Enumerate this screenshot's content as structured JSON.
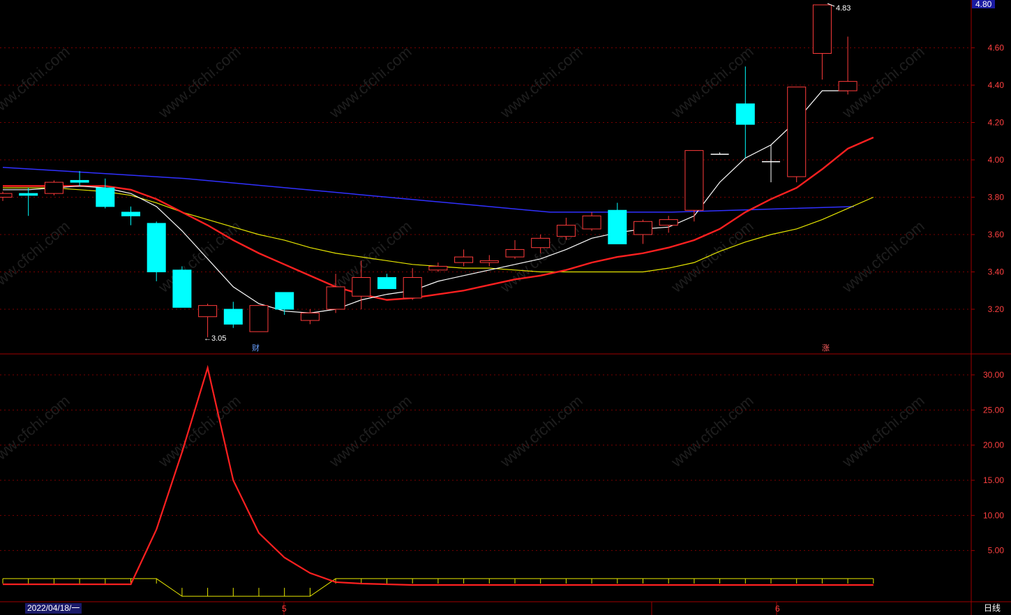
{
  "chart_data": {
    "type": "candlestick",
    "main_panel": {
      "y_ticks": [
        "3.20",
        "3.40",
        "3.60",
        "3.80",
        "4.00",
        "4.20",
        "4.40",
        "4.60"
      ],
      "ylim": [
        3.0,
        4.85
      ],
      "current_price_tag": "4.80",
      "candles": [
        {
          "o": 3.8,
          "h": 3.83,
          "l": 3.78,
          "c": 3.82
        },
        {
          "o": 3.82,
          "h": 3.85,
          "l": 3.7,
          "c": 3.81
        },
        {
          "o": 3.82,
          "h": 3.89,
          "l": 3.81,
          "c": 3.88
        },
        {
          "o": 3.89,
          "h": 3.94,
          "l": 3.86,
          "c": 3.88
        },
        {
          "o": 3.85,
          "h": 3.9,
          "l": 3.74,
          "c": 3.75
        },
        {
          "o": 3.72,
          "h": 3.75,
          "l": 3.65,
          "c": 3.7
        },
        {
          "o": 3.66,
          "h": 3.67,
          "l": 3.35,
          "c": 3.4
        },
        {
          "o": 3.41,
          "h": 3.43,
          "l": 3.21,
          "c": 3.21
        },
        {
          "o": 3.16,
          "h": 3.23,
          "l": 3.05,
          "c": 3.22
        },
        {
          "o": 3.2,
          "h": 3.24,
          "l": 3.1,
          "c": 3.12
        },
        {
          "o": 3.08,
          "h": 3.22,
          "l": 3.08,
          "c": 3.22
        },
        {
          "o": 3.29,
          "h": 3.29,
          "l": 3.17,
          "c": 3.2
        },
        {
          "o": 3.14,
          "h": 3.2,
          "l": 3.12,
          "c": 3.18
        },
        {
          "o": 3.2,
          "h": 3.39,
          "l": 3.18,
          "c": 3.32
        },
        {
          "o": 3.27,
          "h": 3.46,
          "l": 3.2,
          "c": 3.37
        },
        {
          "o": 3.37,
          "h": 3.39,
          "l": 3.31,
          "c": 3.31
        },
        {
          "o": 3.26,
          "h": 3.42,
          "l": 3.25,
          "c": 3.37
        },
        {
          "o": 3.41,
          "h": 3.45,
          "l": 3.4,
          "c": 3.43
        },
        {
          "o": 3.45,
          "h": 3.52,
          "l": 3.43,
          "c": 3.48
        },
        {
          "o": 3.45,
          "h": 3.49,
          "l": 3.43,
          "c": 3.46
        },
        {
          "o": 3.48,
          "h": 3.57,
          "l": 3.47,
          "c": 3.52
        },
        {
          "o": 3.53,
          "h": 3.6,
          "l": 3.5,
          "c": 3.58
        },
        {
          "o": 3.59,
          "h": 3.69,
          "l": 3.57,
          "c": 3.65
        },
        {
          "o": 3.63,
          "h": 3.72,
          "l": 3.62,
          "c": 3.7
        },
        {
          "o": 3.73,
          "h": 3.77,
          "l": 3.56,
          "c": 3.55
        },
        {
          "o": 3.6,
          "h": 3.68,
          "l": 3.55,
          "c": 3.67
        },
        {
          "o": 3.65,
          "h": 3.7,
          "l": 3.61,
          "c": 3.68
        },
        {
          "o": 3.73,
          "h": 4.05,
          "l": 3.67,
          "c": 4.05
        },
        {
          "o": 4.03,
          "h": 4.04,
          "l": 4.03,
          "c": 4.03
        },
        {
          "o": 4.3,
          "h": 4.5,
          "l": 4.01,
          "c": 4.19
        },
        {
          "o": 3.99,
          "h": 4.08,
          "l": 3.88,
          "c": 3.99
        },
        {
          "o": 3.91,
          "h": 4.39,
          "l": 3.88,
          "c": 4.39
        },
        {
          "o": 4.57,
          "h": 4.83,
          "l": 4.43,
          "c": 4.83
        },
        {
          "o": 4.37,
          "h": 4.66,
          "l": 4.35,
          "c": 4.42
        }
      ],
      "ma_short": [
        3.84,
        3.84,
        3.85,
        3.86,
        3.85,
        3.82,
        3.75,
        3.62,
        3.47,
        3.32,
        3.23,
        3.19,
        3.18,
        3.2,
        3.25,
        3.28,
        3.3,
        3.35,
        3.38,
        3.41,
        3.44,
        3.47,
        3.52,
        3.58,
        3.61,
        3.63,
        3.64,
        3.7,
        3.88,
        4.01,
        4.08,
        4.21,
        4.37,
        4.37
      ],
      "ma_mid": [
        3.86,
        3.86,
        3.86,
        3.86,
        3.86,
        3.84,
        3.79,
        3.72,
        3.65,
        3.57,
        3.5,
        3.44,
        3.38,
        3.32,
        3.28,
        3.25,
        3.26,
        3.28,
        3.3,
        3.33,
        3.36,
        3.38,
        3.41,
        3.45,
        3.48,
        3.5,
        3.53,
        3.57,
        3.63,
        3.72,
        3.79,
        3.85,
        3.95,
        4.06,
        4.12
      ],
      "ma_long": [
        3.85,
        3.85,
        3.85,
        3.84,
        3.83,
        3.81,
        3.77,
        3.72,
        3.68,
        3.64,
        3.6,
        3.57,
        3.53,
        3.5,
        3.48,
        3.46,
        3.44,
        3.43,
        3.42,
        3.42,
        3.41,
        3.4,
        3.4,
        3.4,
        3.4,
        3.4,
        3.42,
        3.45,
        3.51,
        3.56,
        3.6,
        3.63,
        3.68,
        3.74,
        3.8
      ],
      "ma_trend": [
        3.96,
        3.94,
        3.92,
        3.9,
        3.87,
        3.84,
        3.81,
        3.78,
        3.75,
        3.72,
        3.72,
        3.72,
        3.73,
        3.74,
        3.75
      ],
      "annotations": {
        "low": "3.05",
        "high": "4.83",
        "low_arrow": "←3.05",
        "high_arrow": "4.83"
      },
      "markers": [
        "财",
        "涨"
      ]
    },
    "sub_panel": {
      "y_ticks": [
        "5.00",
        "10.00",
        "15.00",
        "20.00",
        "25.00",
        "30.00"
      ],
      "ylim": [
        0,
        32
      ],
      "red_line": [
        0.2,
        0.2,
        0.2,
        0.2,
        0.2,
        0.2,
        8,
        19,
        31,
        15,
        7.5,
        4,
        1.8,
        0.5,
        0.3,
        0.2,
        0.1,
        0.1,
        0.1,
        0.1,
        0.1,
        0.1,
        0.1,
        0.1,
        0.1,
        0.1,
        0.1,
        0.1,
        0.1,
        0.1,
        0.1,
        0.1,
        0.1,
        0.1,
        0.1
      ],
      "yellow_line": [
        1,
        1,
        1,
        1,
        1,
        1,
        1,
        -1.5,
        -1.5,
        -1.5,
        -1.5,
        -1.5,
        -1.5,
        1,
        1,
        1,
        1,
        1,
        1,
        1,
        1,
        1,
        1,
        1,
        1,
        1,
        1,
        1,
        1,
        1,
        1,
        1,
        1,
        1,
        1
      ]
    },
    "x_labels": {
      "start_date": "2022/04/18/一",
      "month_5": "5",
      "month_6": "6"
    }
  },
  "ui": {
    "period_label": "日线",
    "watermark": "www.cfchi.com",
    "current_price": "4.80"
  },
  "colors": {
    "up": "#ff3b3b",
    "down": "#00ffff",
    "ma_short": "#ffffff",
    "ma_mid": "#ff2020",
    "ma_long": "#e6e600",
    "ma_trend": "#3030ff",
    "grid": "#7a0000",
    "axis": "#a00000"
  }
}
